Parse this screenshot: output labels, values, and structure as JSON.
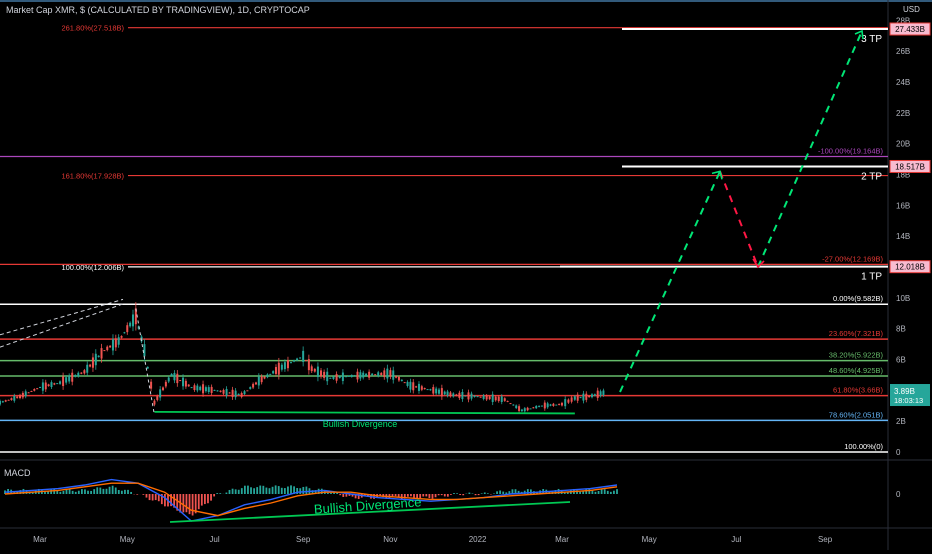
{
  "header": {
    "title": "Market Cap XMR, $ (CALCULATED BY TRADINGVIEW), 1D, CRYPTOCAP",
    "currency": "USD"
  },
  "macd": {
    "label": "MACD",
    "zero_label": "0"
  },
  "colors": {
    "background": "#000000",
    "up": "#26a69a",
    "down": "#ef5350",
    "fib_white": "#ffffff",
    "fib_red": "#e53935",
    "fib_green": "#66bb6a",
    "fib_blue": "#64b5f6",
    "fib_purple": "#ab47bc",
    "path_green": "#00e676",
    "path_red": "#ff1744",
    "macd_line": "#2962ff",
    "signal_line": "#ff6d00"
  },
  "chart_data": {
    "type": "line",
    "title": "Market Cap XMR, $ (CALCULATED BY TRADINGVIEW), 1D, CRYPTOCAP",
    "x_ticks": [
      "Mar",
      "May",
      "Jul",
      "Sep",
      "Nov",
      "2022",
      "Mar",
      "May",
      "Jul",
      "Sep"
    ],
    "y_ticks": [
      "28B",
      "26B",
      "24B",
      "22B",
      "20B",
      "18B",
      "16B",
      "14B",
      "12B",
      "10B",
      "8B",
      "6B",
      "4B",
      "2B",
      "0"
    ],
    "ylim": [
      0,
      28.6
    ],
    "series": [
      {
        "x": [
          "2021-02-01",
          "2021-02-15",
          "2021-03-01",
          "2021-03-15",
          "2021-04-01",
          "2021-04-15",
          "2021-04-25",
          "2021-05-07",
          "2021-05-13",
          "2021-05-20",
          "2021-06-01",
          "2021-06-15",
          "2021-07-01",
          "2021-07-20",
          "2021-08-01",
          "2021-08-15",
          "2021-09-01",
          "2021-09-07",
          "2021-09-20",
          "2021-10-01",
          "2021-10-15",
          "2021-11-01",
          "2021-11-15",
          "2021-12-01",
          "2021-12-15",
          "2022-01-01",
          "2022-01-20",
          "2022-02-01",
          "2022-02-15",
          "2022-03-01",
          "2022-03-10",
          "2022-03-20",
          "2022-04-01"
        ],
        "values": [
          3.2,
          3.6,
          4.2,
          4.5,
          5.2,
          6.6,
          7.2,
          8.8,
          6.6,
          3.2,
          5.0,
          4.2,
          4.0,
          3.7,
          4.6,
          5.4,
          6.2,
          5.4,
          4.8,
          4.9,
          5.0,
          5.1,
          4.3,
          4.0,
          3.7,
          3.6,
          3.4,
          2.7,
          3.0,
          3.1,
          3.5,
          3.6,
          3.89
        ]
      }
    ],
    "fib_levels": [
      {
        "label": "0.00%(9.582B)",
        "value": 9.582,
        "color": "#ffffff"
      },
      {
        "label": "23.60%(7.321B)",
        "value": 7.321,
        "color": "#e53935"
      },
      {
        "label": "38.20%(5.922B)",
        "value": 5.922,
        "color": "#66bb6a"
      },
      {
        "label": "48.60%(4.925B)",
        "value": 4.925,
        "color": "#66bb6a"
      },
      {
        "label": "61.80%(3.66B)",
        "value": 3.66,
        "color": "#e53935"
      },
      {
        "label": "78.60%(2.051B)",
        "value": 2.051,
        "color": "#64b5f6"
      },
      {
        "label": "100.00%(0)",
        "value": 0,
        "color": "#ffffff"
      }
    ],
    "ext_levels_left": [
      {
        "label": "261.80%(27.518B)",
        "value": 27.518,
        "color": "#e53935"
      },
      {
        "label": "161.80%(17.928B)",
        "value": 17.928,
        "color": "#e53935"
      },
      {
        "label": "100.00%(12.006B)",
        "value": 12.006,
        "color": "#ffffff"
      }
    ],
    "ext_levels_right": [
      {
        "label": "-100.00%(19.164B)",
        "value": 19.164,
        "color": "#ab47bc"
      },
      {
        "label": "-27.00%(12.169B)",
        "value": 12.169,
        "color": "#e53935"
      }
    ],
    "targets": [
      {
        "label": "3 TP",
        "value": 27.433,
        "tag": "27.433B"
      },
      {
        "label": "2 TP",
        "value": 18.517,
        "tag": "18.517B"
      },
      {
        "label": "1 TP",
        "value": 12.018,
        "tag": "12.018B"
      }
    ],
    "current_price": {
      "value": 3.89,
      "label": "3.89B",
      "countdown": "18:03:13"
    },
    "annotations": [
      "Bullish Divergence",
      "Bullish Divergence"
    ],
    "macd_lines": {
      "macd": [
        0.1,
        0.2,
        0.3,
        0.5,
        0.8,
        0.6,
        -0.2,
        -1.5,
        -1.2,
        -0.6,
        -0.3,
        0.1,
        0.2,
        0.0,
        -0.2,
        -0.3,
        -0.4,
        -0.3,
        -0.2,
        0.0,
        0.1,
        0.2,
        0.3,
        0.5
      ],
      "signal": [
        0.0,
        0.1,
        0.2,
        0.4,
        0.6,
        0.6,
        0.1,
        -0.9,
        -1.2,
        -0.8,
        -0.5,
        -0.1,
        0.1,
        0.1,
        -0.1,
        -0.2,
        -0.3,
        -0.3,
        -0.2,
        -0.1,
        0.0,
        0.1,
        0.2,
        0.4
      ]
    }
  }
}
